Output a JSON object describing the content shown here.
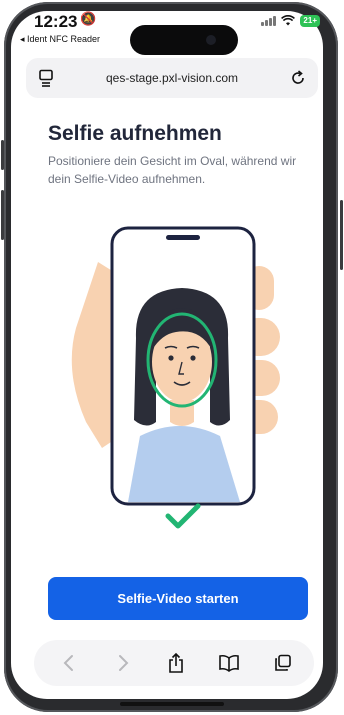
{
  "status_bar": {
    "time": "12:23",
    "back_app_label": "◂ Ident NFC Reader",
    "battery": "21+"
  },
  "browser": {
    "url": "qes-stage.pxl-vision.com",
    "tabs_icon": "tab-overview-icon",
    "reload_icon": "reload-icon"
  },
  "page": {
    "title": "Selfie aufnehmen",
    "subtitle": "Positioniere dein Gesicht im Oval, während wir dein Selfie-Video aufnehmen.",
    "start_button": "Selfie-Video starten"
  },
  "toolbar": {
    "items": [
      "back-icon",
      "forward-icon",
      "share-icon",
      "bookmarks-icon",
      "tabs-icon"
    ]
  },
  "colors": {
    "primary": "#1462e6",
    "check": "#22b573",
    "title": "#22273a",
    "text_muted": "#6f7480"
  }
}
